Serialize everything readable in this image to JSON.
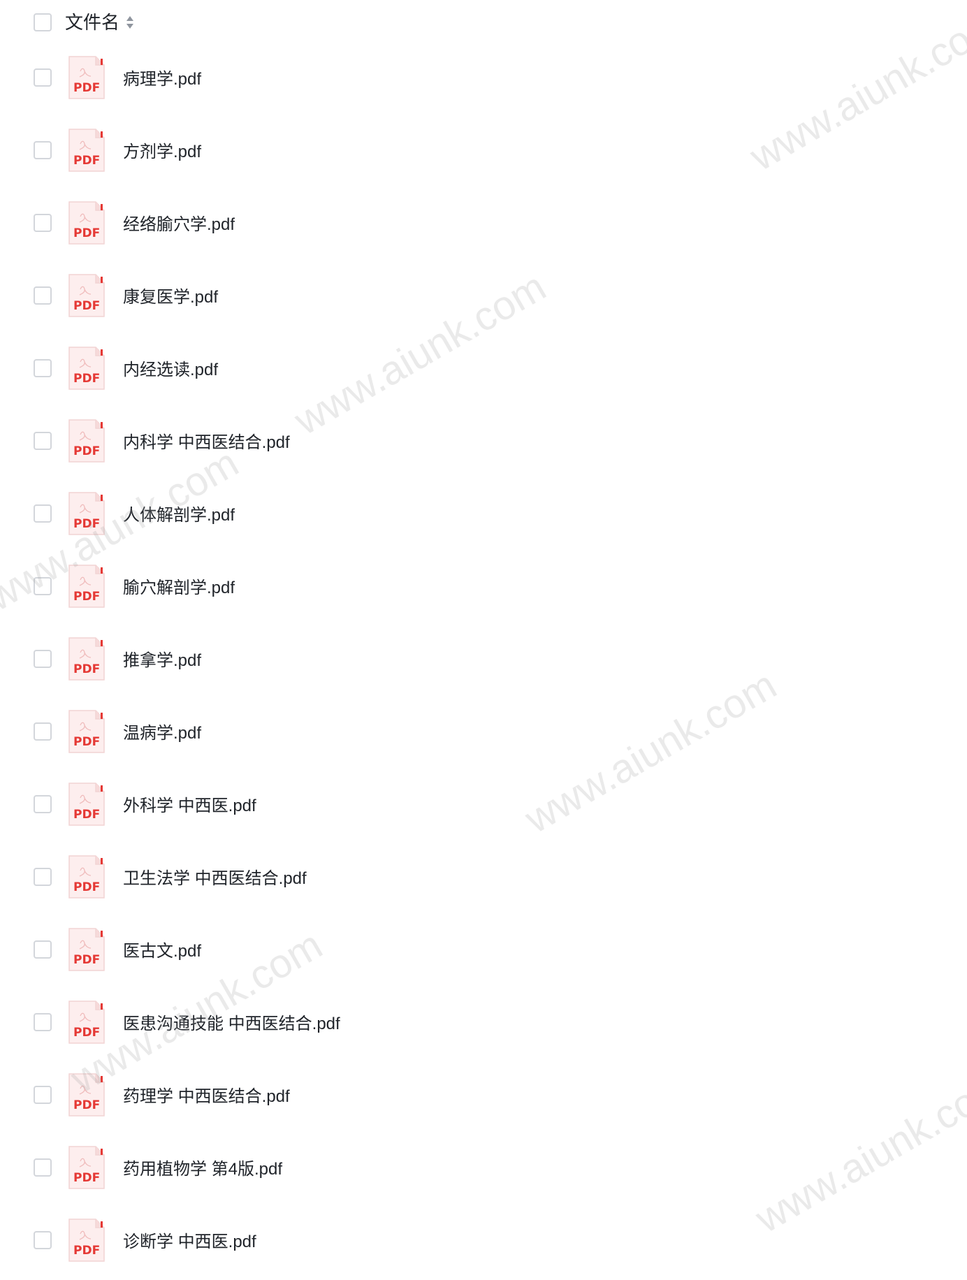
{
  "header": {
    "column_label": "文件名"
  },
  "files": [
    {
      "name": "病理学.pdf",
      "icon": "pdf-file-icon"
    },
    {
      "name": "方剂学.pdf",
      "icon": "pdf-file-icon"
    },
    {
      "name": "经络腧穴学.pdf",
      "icon": "pdf-file-icon"
    },
    {
      "name": "康复医学.pdf",
      "icon": "pdf-file-icon"
    },
    {
      "name": "内经选读.pdf",
      "icon": "pdf-file-icon"
    },
    {
      "name": "内科学 中西医结合.pdf",
      "icon": "pdf-file-icon"
    },
    {
      "name": "人体解剖学.pdf",
      "icon": "pdf-file-icon"
    },
    {
      "name": "腧穴解剖学.pdf",
      "icon": "pdf-file-icon"
    },
    {
      "name": "推拿学.pdf",
      "icon": "pdf-file-icon"
    },
    {
      "name": "温病学.pdf",
      "icon": "pdf-file-icon"
    },
    {
      "name": "外科学 中西医.pdf",
      "icon": "pdf-file-icon"
    },
    {
      "name": "卫生法学 中西医结合.pdf",
      "icon": "pdf-file-icon"
    },
    {
      "name": "医古文.pdf",
      "icon": "pdf-file-icon"
    },
    {
      "name": "医患沟通技能 中西医结合.pdf",
      "icon": "pdf-file-icon"
    },
    {
      "name": "药理学 中西医结合.pdf",
      "icon": "pdf-file-icon"
    },
    {
      "name": "药用植物学 第4版.pdf",
      "icon": "pdf-file-icon"
    },
    {
      "name": "诊断学 中西医.pdf",
      "icon": "pdf-file-icon"
    }
  ],
  "pdf_badge_text": "PDF",
  "watermark_text": "www.aiunk.com",
  "colors": {
    "pdf_red": "#e53935",
    "checkbox_border": "#d3d6db",
    "text": "#1f2329",
    "sort_icon": "#8f959e"
  }
}
